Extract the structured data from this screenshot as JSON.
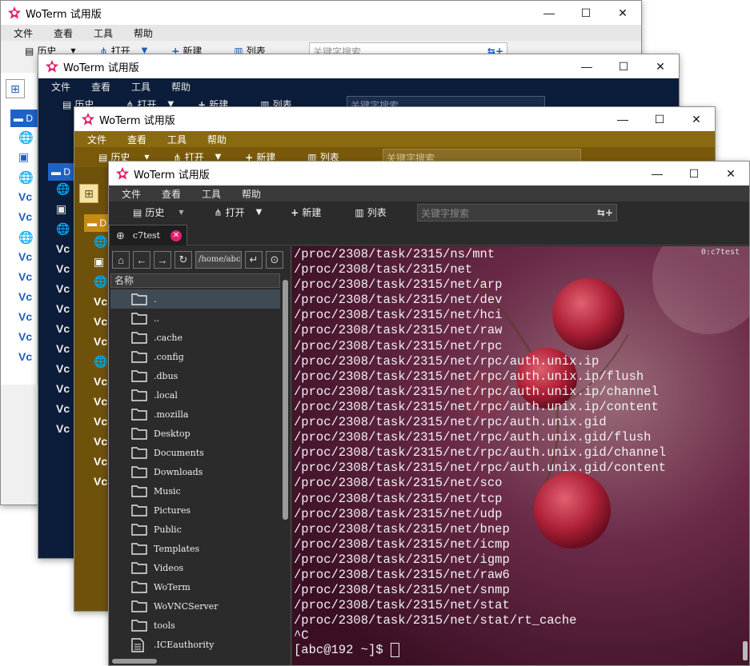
{
  "app": {
    "title": "WoTerm 试用版",
    "menu": [
      "文件",
      "查看",
      "工具",
      "帮助"
    ],
    "toolbar": {
      "history": "历史",
      "open": "打开",
      "new": "新建",
      "list": "列表",
      "search_placeholder": "关键字搜索"
    }
  },
  "window1": {
    "tree_root": "D"
  },
  "window2": {
    "tree_root": "D"
  },
  "window3": {
    "tree_root": "D"
  },
  "window4": {
    "tab_label": "c7test",
    "path": "/home/abc",
    "file_header": "名称",
    "files": [
      ".",
      "..",
      ".cache",
      ".config",
      ".dbus",
      ".local",
      ".mozilla",
      "Desktop",
      "Documents",
      "Downloads",
      "Music",
      "Pictures",
      "Public",
      "Templates",
      "Videos",
      "WoTerm",
      "WoVNCServer",
      "tools",
      ".ICEauthority"
    ],
    "terminal_tag": "0:c7test",
    "terminal_lines": [
      "/proc/2308/task/2315/ns/mnt",
      "/proc/2308/task/2315/net",
      "/proc/2308/task/2315/net/arp",
      "/proc/2308/task/2315/net/dev",
      "/proc/2308/task/2315/net/hci",
      "/proc/2308/task/2315/net/raw",
      "/proc/2308/task/2315/net/rpc",
      "/proc/2308/task/2315/net/rpc/auth.unix.ip",
      "/proc/2308/task/2315/net/rpc/auth.unix.ip/flush",
      "/proc/2308/task/2315/net/rpc/auth.unix.ip/channel",
      "/proc/2308/task/2315/net/rpc/auth.unix.ip/content",
      "/proc/2308/task/2315/net/rpc/auth.unix.gid",
      "/proc/2308/task/2315/net/rpc/auth.unix.gid/flush",
      "/proc/2308/task/2315/net/rpc/auth.unix.gid/channel",
      "/proc/2308/task/2315/net/rpc/auth.unix.gid/content",
      "/proc/2308/task/2315/net/sco",
      "/proc/2308/task/2315/net/tcp",
      "/proc/2308/task/2315/net/udp",
      "/proc/2308/task/2315/net/bnep",
      "/proc/2308/task/2315/net/icmp",
      "/proc/2308/task/2315/net/igmp",
      "/proc/2308/task/2315/net/raw6",
      "/proc/2308/task/2315/net/snmp",
      "/proc/2308/task/2315/net/stat",
      "/proc/2308/task/2315/net/stat/rt_cache",
      "^C"
    ],
    "prompt": "[abc@192 ~]$"
  },
  "theme": {
    "w1": "#f0f0f0",
    "w2": "#0d2142",
    "w3": "#7a5a0a",
    "w4": "#2b2b2b",
    "accent_pink": "#e0226e"
  }
}
